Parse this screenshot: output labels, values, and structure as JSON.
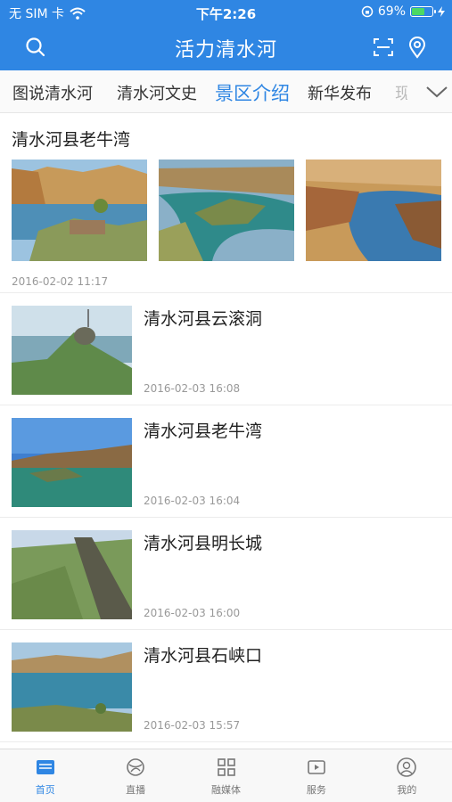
{
  "status_bar": {
    "carrier": "无 SIM 卡",
    "time": "下午2:26",
    "battery_percent_label": "69%",
    "battery_level": 0.69
  },
  "header": {
    "title": "活力清水河",
    "search_icon": "search-icon",
    "scan_icon": "scan-icon",
    "location_icon": "location-pin-icon"
  },
  "tabs": [
    {
      "label": "图说清水河"
    },
    {
      "label": "清水河文史"
    },
    {
      "label": "景区介绍"
    },
    {
      "label": "新华发布"
    },
    {
      "label": "现"
    }
  ],
  "gallery": {
    "title": "清水河县老牛湾",
    "time": "2016-02-02 11:17"
  },
  "items": [
    {
      "title": "清水河县云滚洞",
      "time": "2016-02-03 16:08"
    },
    {
      "title": "清水河县老牛湾",
      "time": "2016-02-03 16:04"
    },
    {
      "title": "清水河县明长城",
      "time": "2016-02-03 16:00"
    },
    {
      "title": "清水河县石峡口",
      "time": "2016-02-03 15:57"
    }
  ],
  "bottom_nav": [
    {
      "label": "首页"
    },
    {
      "label": "直播"
    },
    {
      "label": "融媒体"
    },
    {
      "label": "服务"
    },
    {
      "label": "我的"
    }
  ],
  "colors": {
    "accent": "#2f86e3",
    "inactive": "#777777"
  }
}
